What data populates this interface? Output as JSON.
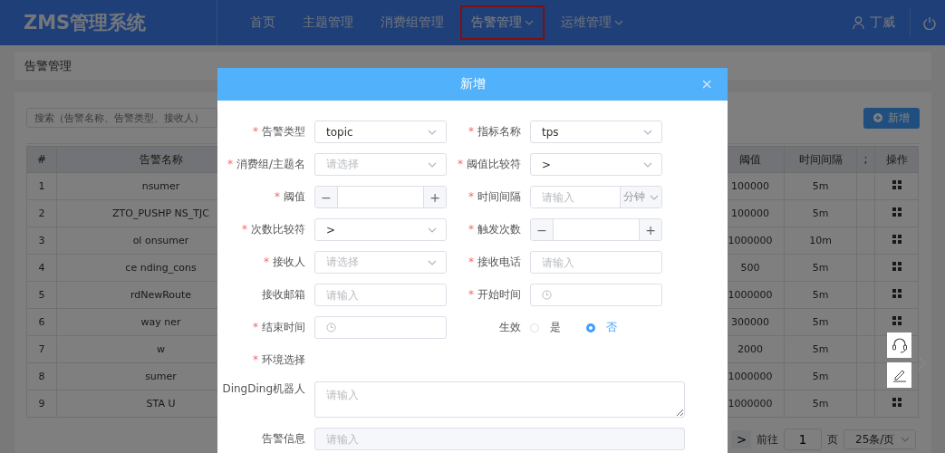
{
  "header": {
    "logo": "ZMS管理系统",
    "nav": [
      {
        "label": "首页",
        "selected": false,
        "dropdown": false
      },
      {
        "label": "主题管理",
        "selected": false,
        "dropdown": false
      },
      {
        "label": "消费组管理",
        "selected": false,
        "dropdown": false
      },
      {
        "label": "告警管理",
        "selected": true,
        "dropdown": true
      },
      {
        "label": "运维管理",
        "selected": false,
        "dropdown": true
      }
    ],
    "user": "丁威"
  },
  "breadcrumb": "告警管理",
  "toolbar": {
    "search": {
      "placeholder": "搜索（告警名称、告警类型、接收人）"
    },
    "add_button": "新增"
  },
  "table": {
    "columns": [
      "#",
      "告警名称",
      "阈值",
      "时间间隔",
      ";",
      "操作"
    ],
    "rows": [
      {
        "index": "1",
        "name": "nsumer",
        "threshold": "100000",
        "interval": "5m"
      },
      {
        "index": "2",
        "name": "ZTO_PUSHP    NS_TJC",
        "threshold": "100000",
        "interval": "5m"
      },
      {
        "index": "3",
        "name": "ol    onsumer",
        "threshold": "1000000",
        "interval": "10m"
      },
      {
        "index": "4",
        "name": "ce    nding_cons",
        "threshold": "500",
        "interval": "5m"
      },
      {
        "index": "5",
        "name": "rdNewRoute",
        "threshold": "1000000",
        "interval": "5m"
      },
      {
        "index": "6",
        "name": "way    ner",
        "threshold": "300000",
        "interval": "5m"
      },
      {
        "index": "7",
        "name": "w",
        "threshold": "2000",
        "interval": "5m"
      },
      {
        "index": "8",
        "name": "sumer",
        "threshold": "1000000",
        "interval": "5m"
      },
      {
        "index": "9",
        "name": "STA    U",
        "threshold": "1000000",
        "interval": "5m"
      }
    ]
  },
  "pagination": {
    "next": ">",
    "goto": "前往",
    "page": "1",
    "page_unit": "页",
    "page_size": "25条/页"
  },
  "dialog": {
    "title": "新增",
    "close": "×",
    "fields": [
      {
        "kind": "select",
        "mark": "*",
        "label": "告警类型",
        "value": "topic"
      },
      {
        "kind": "select",
        "mark": "*",
        "label": "指标名称",
        "value": "tps"
      },
      {
        "kind": "select",
        "mark": "*",
        "label": "消费组/主题名",
        "placeholder": "请选择"
      },
      {
        "kind": "select",
        "mark": "*",
        "label": "阈值比较符",
        "value": ">"
      },
      {
        "kind": "number",
        "mark": "*",
        "label": "阈值",
        "minus": "−",
        "plus": "+"
      },
      {
        "kind": "unit",
        "mark": "*",
        "label": "时间间隔",
        "placeholder": "请输入",
        "unit": "分钟"
      },
      {
        "kind": "select",
        "mark": "*",
        "label": "次数比较符",
        "value": ">"
      },
      {
        "kind": "number",
        "mark": "*",
        "label": "触发次数",
        "minus": "−",
        "plus": "+"
      },
      {
        "kind": "select",
        "mark": "*",
        "label": "接收人",
        "placeholder": "请选择"
      },
      {
        "kind": "input",
        "mark": "*",
        "label": "接收电话",
        "placeholder": "请输入"
      },
      {
        "kind": "input",
        "label": "接收邮箱",
        "placeholder": "请输入"
      },
      {
        "kind": "time",
        "mark": "*",
        "label": "开始时间"
      },
      {
        "kind": "time",
        "mark": "*",
        "label": "结束时间"
      },
      {
        "kind": "radio",
        "label": "生效",
        "options": [
          {
            "label": "是",
            "selected": false
          },
          {
            "label": "否",
            "selected": true
          }
        ]
      },
      {
        "kind": "section",
        "mark": "*",
        "label": "环境选择"
      },
      {
        "kind": "textarea",
        "label": "DingDing机器人",
        "placeholder": "请输入"
      },
      {
        "kind": "disabled",
        "label": "告警信息",
        "placeholder": "请输入"
      }
    ]
  }
}
